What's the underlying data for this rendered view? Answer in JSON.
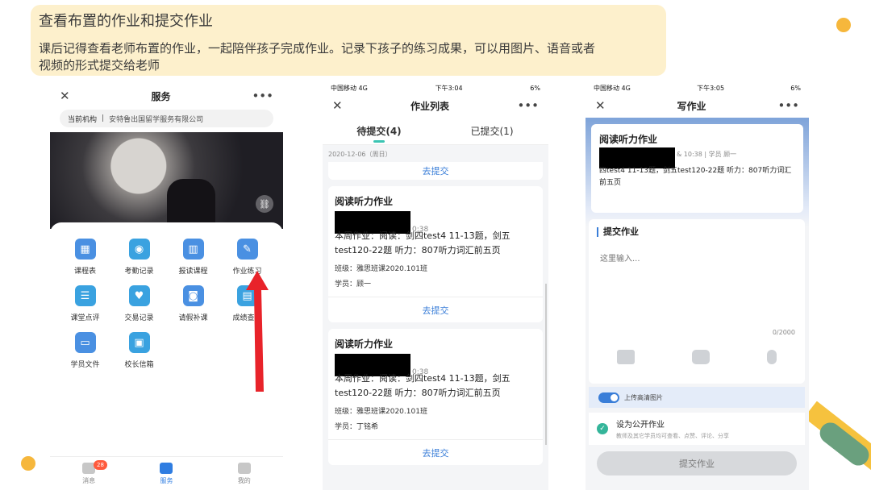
{
  "slide": {
    "title": "查看布置的作业和提交作业",
    "desc": "课后记得查看老师布置的作业，一起陪伴孩子完成作业。记录下孩子的练习成果，可以用图片、语音或者视频的形式提交给老师"
  },
  "phone1": {
    "title": "服务",
    "institution_label": "当前机构",
    "institution_name": "安特鲁出国留学服务有限公司",
    "services": [
      {
        "label": "课程表",
        "icon": "calendar-icon",
        "color": "#4a90e2"
      },
      {
        "label": "考勤记录",
        "icon": "location-pin-icon",
        "color": "#3aa2e0"
      },
      {
        "label": "报读课程",
        "icon": "books-icon",
        "color": "#4a90e2"
      },
      {
        "label": "作业练习",
        "icon": "pencil-icon",
        "color": "#4a90e2"
      },
      {
        "label": "课堂点评",
        "icon": "comment-icon",
        "color": "#3aa2e0"
      },
      {
        "label": "交易记录",
        "icon": "heart-shield-icon",
        "color": "#3aa2e0"
      },
      {
        "label": "请假补课",
        "icon": "person-card-icon",
        "color": "#4a90e2"
      },
      {
        "label": "成绩查询",
        "icon": "report-icon",
        "color": "#3aa2e0"
      },
      {
        "label": "学员文件",
        "icon": "folder-icon",
        "color": "#4a90e2"
      },
      {
        "label": "校长信箱",
        "icon": "mailbox-icon",
        "color": "#3aa2e0"
      }
    ],
    "tabs": [
      {
        "label": "消息",
        "badge": "28"
      },
      {
        "label": "服务"
      },
      {
        "label": "我的"
      }
    ]
  },
  "phone2": {
    "status": {
      "carrier": "中国移动  4G",
      "time": "下午3:04",
      "battery": "6%"
    },
    "title": "作业列表",
    "tabs": [
      "待提交(4)",
      "已提交(1)"
    ],
    "date": "2020-12-06（周日）",
    "submit_label": "去提交",
    "cards": [
      {
        "title": "阅读听力作业",
        "time_suffix": "0:38",
        "content": "本周作业：阅读：剑四test4   11-13题，剑五test120-22题        听力：807听力词汇前五页",
        "class_line": "班级：雅思班课2020.101班",
        "student_line": "学员：顾一"
      },
      {
        "title": "阅读听力作业",
        "time_suffix": "0:38",
        "content": "本周作业：阅读：剑四test4   11-13题，剑五test120-22题        听力：807听力词汇前五页",
        "class_line": "班级：雅思班课2020.101班",
        "student_line": "学员：丁铭希"
      }
    ]
  },
  "phone3": {
    "status": {
      "carrier": "中国移动  4G",
      "time": "下午3:05",
      "battery": "6%"
    },
    "title": "写作业",
    "card": {
      "title": "阅读听力作业",
      "time_meta": "& 10:38  |  学员  顾一",
      "content": "四test4   11-13题，剑五test120-22题        听力：807听力词汇前五页"
    },
    "section_title": "提交作业",
    "input_placeholder": "这里输入...",
    "counter": "0/2000",
    "hd_label": "上传高清图片",
    "public_title": "设为公开作业",
    "public_desc": "教师及其它学员均可查看、点赞、评论、分享",
    "submit_button": "提交作业"
  },
  "colors": {
    "accent": "#3a7ed8",
    "highlight": "#fdf0cc",
    "teal": "#3bc4b3"
  }
}
